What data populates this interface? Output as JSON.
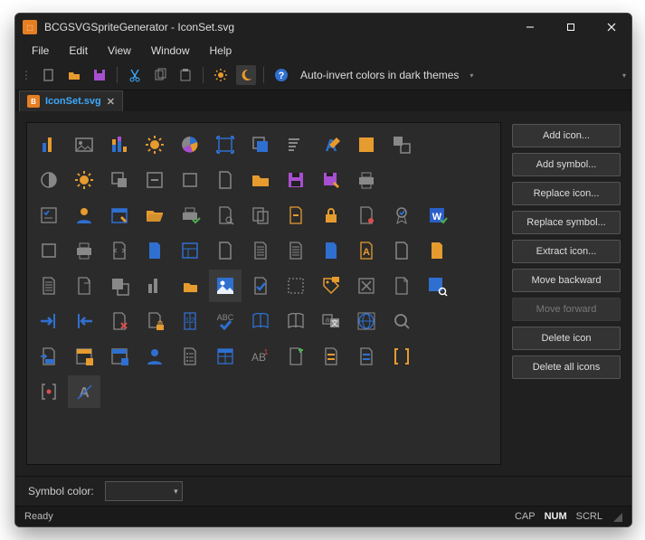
{
  "title": "BCGSVGSpriteGenerator - IconSet.svg",
  "menubar": [
    "File",
    "Edit",
    "View",
    "Window",
    "Help"
  ],
  "toolbar": {
    "items": [
      {
        "name": "new-icon",
        "type": "new"
      },
      {
        "name": "open-icon",
        "type": "open"
      },
      {
        "name": "save-icon",
        "type": "save"
      },
      {
        "sep": true
      },
      {
        "name": "cut-icon",
        "type": "cut"
      },
      {
        "name": "copy-icon",
        "type": "copy"
      },
      {
        "name": "paste-icon",
        "type": "paste"
      },
      {
        "sep": true
      },
      {
        "name": "light-theme-icon",
        "type": "sun"
      },
      {
        "name": "dark-theme-icon",
        "type": "moon",
        "active": true
      },
      {
        "sep": true
      },
      {
        "name": "help-icon",
        "type": "help"
      }
    ],
    "auto_invert_label": "Auto-invert colors in dark themes"
  },
  "tab": {
    "label": "IconSet.svg"
  },
  "side_buttons": [
    {
      "label": "Add icon...",
      "name": "add-icon-button"
    },
    {
      "label": "Add symbol...",
      "name": "add-symbol-button"
    },
    {
      "label": "Replace icon...",
      "name": "replace-icon-button"
    },
    {
      "label": "Replace symbol...",
      "name": "replace-symbol-button"
    },
    {
      "label": "Extract icon...",
      "name": "extract-icon-button"
    },
    {
      "label": "Move backward",
      "name": "move-backward-button"
    },
    {
      "label": "Move forward",
      "name": "move-forward-button",
      "disabled": true
    },
    {
      "label": "Delete icon",
      "name": "delete-icon-button"
    },
    {
      "label": "Delete all icons",
      "name": "delete-all-icons-button"
    }
  ],
  "symbol_color_label": "Symbol color:",
  "status": {
    "left": "Ready",
    "caps": "CAP",
    "num": "NUM",
    "scrl": "SCRL"
  },
  "icons": [
    {
      "name": "bar-chart-icon",
      "c": "blue-orange",
      "t": "bars"
    },
    {
      "name": "image-gray-icon",
      "c": "gray",
      "t": "image"
    },
    {
      "name": "stacked-chart-icon",
      "c": "blue-orange",
      "t": "stacked"
    },
    {
      "name": "sun-icon",
      "c": "orange",
      "t": "sun"
    },
    {
      "name": "pie-chart-icon",
      "c": "multi",
      "t": "pie"
    },
    {
      "name": "select-icon",
      "c": "blue",
      "t": "frame-out"
    },
    {
      "name": "layers-icon",
      "c": "gray-blue",
      "t": "layers"
    },
    {
      "name": "align-left-icon",
      "c": "gray",
      "t": "align-l"
    },
    {
      "name": "font-a-icon",
      "c": "blue-orange",
      "t": "A"
    },
    {
      "name": "square-orange-icon",
      "c": "orange",
      "t": "square"
    },
    {
      "name": "diff-squares-icon",
      "c": "gray",
      "t": "two-sq"
    },
    {
      "name": "blank",
      "t": "blank"
    },
    {
      "name": "contrast-icon",
      "c": "gray",
      "t": "contrast"
    },
    {
      "name": "brightness-icon",
      "c": "orange",
      "t": "sun"
    },
    {
      "name": "behind-icon",
      "c": "gray",
      "t": "behind"
    },
    {
      "name": "minus-box-icon",
      "c": "gray",
      "t": "box-minus"
    },
    {
      "name": "frame-icon",
      "c": "gray",
      "t": "frame-in"
    },
    {
      "name": "doc-icon",
      "c": "gray",
      "t": "doc"
    },
    {
      "name": "folder-icon",
      "c": "orange",
      "t": "folder"
    },
    {
      "name": "floppy-purple-icon",
      "c": "purple",
      "t": "floppy"
    },
    {
      "name": "floppy-edit-icon",
      "c": "purple",
      "t": "floppy-pen"
    },
    {
      "name": "printer-icon",
      "c": "gray",
      "t": "printer"
    },
    {
      "name": "blank",
      "t": "blank"
    },
    {
      "name": "blank",
      "t": "blank"
    },
    {
      "name": "checklist-icon",
      "c": "gray",
      "t": "checklist"
    },
    {
      "name": "user-orange-icon",
      "c": "orange-blue",
      "t": "user"
    },
    {
      "name": "calendar-orange-icon",
      "c": "blue-orange",
      "t": "calendar-edit"
    },
    {
      "name": "folder-open-icon",
      "c": "orange",
      "t": "folder-open"
    },
    {
      "name": "printer-check-icon",
      "c": "gray",
      "t": "printer-check"
    },
    {
      "name": "doc-search-icon",
      "c": "gray",
      "t": "doc-search"
    },
    {
      "name": "copy-icon-2",
      "c": "gray",
      "t": "copy"
    },
    {
      "name": "doc-check-icon",
      "c": "orange",
      "t": "doc-line"
    },
    {
      "name": "lock-orange-icon",
      "c": "orange",
      "t": "lock"
    },
    {
      "name": "doc-gray-icon",
      "c": "gray",
      "t": "doc-dot"
    },
    {
      "name": "ribbon-check-icon",
      "c": "gray",
      "t": "ribbon"
    },
    {
      "name": "word-check-icon",
      "c": "royal",
      "t": "word"
    },
    {
      "name": "frame2-icon",
      "c": "gray",
      "t": "frame-in"
    },
    {
      "name": "printer2-icon",
      "c": "gray",
      "t": "printer"
    },
    {
      "name": "doc-swap-icon",
      "c": "gray",
      "t": "doc-arrows"
    },
    {
      "name": "doc-blue-icon",
      "c": "blue",
      "t": "doc-fill"
    },
    {
      "name": "layout-blue-icon",
      "c": "blue",
      "t": "layout"
    },
    {
      "name": "doc2-icon",
      "c": "gray",
      "t": "doc"
    },
    {
      "name": "doc-gradient-icon",
      "c": "gray",
      "t": "doc-lines"
    },
    {
      "name": "doc-block-icon",
      "c": "gray",
      "t": "doc-lines"
    },
    {
      "name": "doc-blue2-icon",
      "c": "blue",
      "t": "doc-fill"
    },
    {
      "name": "doc-orange-A-icon",
      "c": "orange",
      "t": "A-doc"
    },
    {
      "name": "doc-x-icon",
      "c": "gray",
      "t": "doc"
    },
    {
      "name": "doc-orange-icon",
      "c": "orange",
      "t": "doc-fill"
    },
    {
      "name": "doc-content-icon",
      "c": "gray",
      "t": "doc-lines"
    },
    {
      "name": "doc-clip-icon",
      "c": "gray",
      "t": "doc-clip"
    },
    {
      "name": "overlap-icon",
      "c": "gray",
      "t": "overlap"
    },
    {
      "name": "chart-bars-icon",
      "c": "gray",
      "t": "bars"
    },
    {
      "name": "folder-small-icon",
      "c": "orange",
      "t": "folder-mini"
    },
    {
      "name": "photo-blue-icon",
      "c": "blue",
      "t": "photo",
      "sel": true
    },
    {
      "name": "doc-check2-icon",
      "c": "blue",
      "t": "doc-check"
    },
    {
      "name": "doc-dotted-icon",
      "c": "gray",
      "t": "dotted-box"
    },
    {
      "name": "tag-icon",
      "c": "orange",
      "t": "tag"
    },
    {
      "name": "cross-box-icon",
      "c": "gray",
      "t": "cross"
    },
    {
      "name": "doc-open-icon",
      "c": "gray",
      "t": "doc-corner"
    },
    {
      "name": "image-search-icon",
      "c": "blue",
      "t": "img-search"
    },
    {
      "name": "import-blue-icon",
      "c": "blue",
      "t": "arrow-in"
    },
    {
      "name": "export-blue-icon",
      "c": "blue",
      "t": "arrow-out"
    },
    {
      "name": "doc-x2-icon",
      "c": "gray-red",
      "t": "doc-x"
    },
    {
      "name": "doc-lock-icon",
      "c": "gray-orange",
      "t": "doc-lock"
    },
    {
      "name": "doc-12-icon",
      "c": "blue",
      "t": "doc-12"
    },
    {
      "name": "abc-check-icon",
      "c": "blue",
      "t": "abc"
    },
    {
      "name": "book-blue-icon",
      "c": "blue",
      "t": "book"
    },
    {
      "name": "book-gray-icon",
      "c": "gray",
      "t": "book"
    },
    {
      "name": "translate-icon",
      "c": "gray-blue",
      "t": "translate"
    },
    {
      "name": "globe-blue-icon",
      "c": "blue",
      "t": "globe"
    },
    {
      "name": "search-gray-icon",
      "c": "gray",
      "t": "search"
    },
    {
      "name": "blank",
      "t": "blank"
    },
    {
      "name": "import-doc-icon",
      "c": "gray-blue",
      "t": "doc-arrow"
    },
    {
      "name": "panel-orange-icon",
      "c": "orange",
      "t": "panel"
    },
    {
      "name": "panel-blue-icon",
      "c": "blue",
      "t": "panel"
    },
    {
      "name": "man-shadow-icon",
      "c": "blue",
      "t": "user"
    },
    {
      "name": "doc-list-icon",
      "c": "gray",
      "t": "doc-list"
    },
    {
      "name": "grid-blue-icon",
      "c": "blue",
      "t": "grid"
    },
    {
      "name": "ab1-icon",
      "c": "gray-red",
      "t": "AB1"
    },
    {
      "name": "doc-plus-icon",
      "c": "gray",
      "t": "doc-plus"
    },
    {
      "name": "doc-pink-icon",
      "c": "gray-orange",
      "t": "doc-stripe"
    },
    {
      "name": "doc-blue3-icon",
      "c": "blue",
      "t": "doc-stripe"
    },
    {
      "name": "bracket-orange-icon",
      "c": "orange",
      "t": "bracket"
    },
    {
      "name": "blank",
      "t": "blank"
    },
    {
      "name": "bracket-red-icon",
      "c": "red",
      "t": "bracket-dot"
    },
    {
      "name": "font-A-gray-icon",
      "c": "gray",
      "t": "A-slash",
      "sel": true
    },
    {
      "name": "blank",
      "t": "blank"
    },
    {
      "name": "blank",
      "t": "blank"
    },
    {
      "name": "blank",
      "t": "blank"
    },
    {
      "name": "blank",
      "t": "blank"
    },
    {
      "name": "blank",
      "t": "blank"
    },
    {
      "name": "blank",
      "t": "blank"
    },
    {
      "name": "blank",
      "t": "blank"
    },
    {
      "name": "blank",
      "t": "blank"
    },
    {
      "name": "blank",
      "t": "blank"
    },
    {
      "name": "blank",
      "t": "blank"
    }
  ]
}
